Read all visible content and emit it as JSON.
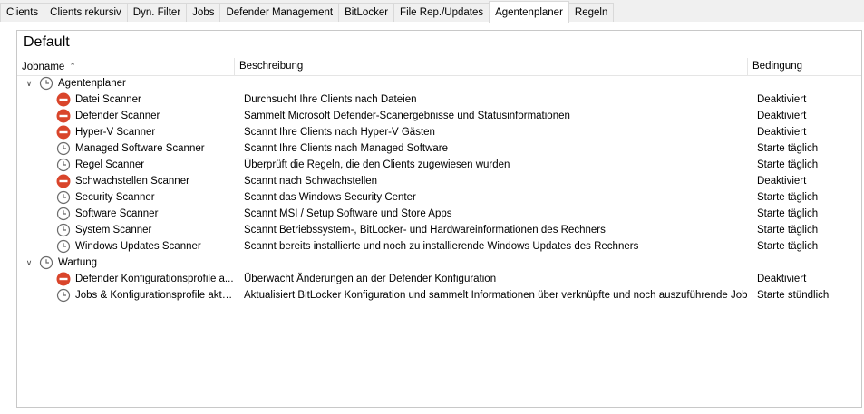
{
  "tabs": [
    {
      "label": "Clients",
      "active": false
    },
    {
      "label": "Clients rekursiv",
      "active": false
    },
    {
      "label": "Dyn. Filter",
      "active": false
    },
    {
      "label": "Jobs",
      "active": false
    },
    {
      "label": "Defender Management",
      "active": false
    },
    {
      "label": "BitLocker",
      "active": false
    },
    {
      "label": "File Rep./Updates",
      "active": false
    },
    {
      "label": "Agentenplaner",
      "active": true
    },
    {
      "label": "Regeln",
      "active": false
    }
  ],
  "panel": {
    "title": "Default",
    "columns": {
      "name": "Jobname",
      "description": "Beschreibung",
      "condition": "Bedingung"
    }
  },
  "groups": [
    {
      "label": "Agentenplaner",
      "items": [
        {
          "name": "Datei Scanner",
          "description": "Durchsucht Ihre Clients nach Dateien",
          "condition": "Deaktiviert",
          "icon": "disabled-icon"
        },
        {
          "name": "Defender Scanner",
          "description": "Sammelt Microsoft Defender-Scanergebnisse und Statusinformationen",
          "condition": "Deaktiviert",
          "icon": "disabled-icon"
        },
        {
          "name": "Hyper-V Scanner",
          "description": "Scannt Ihre Clients nach Hyper-V Gästen",
          "condition": "Deaktiviert",
          "icon": "disabled-icon"
        },
        {
          "name": "Managed Software Scanner",
          "description": "Scannt Ihre Clients nach Managed Software",
          "condition": "Starte täglich",
          "icon": "clock-icon"
        },
        {
          "name": "Regel Scanner",
          "description": "Überprüft die Regeln, die den Clients zugewiesen wurden",
          "condition": "Starte täglich",
          "icon": "clock-icon"
        },
        {
          "name": "Schwachstellen Scanner",
          "description": "Scannt nach Schwachstellen",
          "condition": "Deaktiviert",
          "icon": "disabled-icon"
        },
        {
          "name": "Security Scanner",
          "description": "Scannt das Windows Security Center",
          "condition": "Starte täglich",
          "icon": "clock-icon"
        },
        {
          "name": "Software Scanner",
          "description": "Scannt MSI / Setup Software und Store Apps",
          "condition": "Starte täglich",
          "icon": "clock-icon"
        },
        {
          "name": "System Scanner",
          "description": "Scannt Betriebssystem-, BitLocker- und Hardwareinformationen des Rechners",
          "condition": "Starte täglich",
          "icon": "clock-icon"
        },
        {
          "name": "Windows Updates Scanner",
          "description": "Scannt bereits installierte und noch zu installierende Windows Updates des Rechners",
          "condition": "Starte täglich",
          "icon": "clock-icon"
        }
      ]
    },
    {
      "label": "Wartung",
      "items": [
        {
          "name": "Defender Konfigurationsprofile a...",
          "description": "Überwacht Änderungen an der Defender Konfiguration",
          "condition": "Deaktiviert",
          "icon": "disabled-icon"
        },
        {
          "name": "Jobs & Konfigurationsprofile aktu...",
          "description": "Aktualisiert BitLocker Konfiguration und sammelt Informationen über verknüpfte und noch auszuführende Jobs. ...",
          "condition": "Starte stündlich",
          "icon": "clock-icon"
        }
      ]
    }
  ],
  "colors": {
    "disabled": "#d9452b",
    "clock": "#6b6b6b"
  }
}
